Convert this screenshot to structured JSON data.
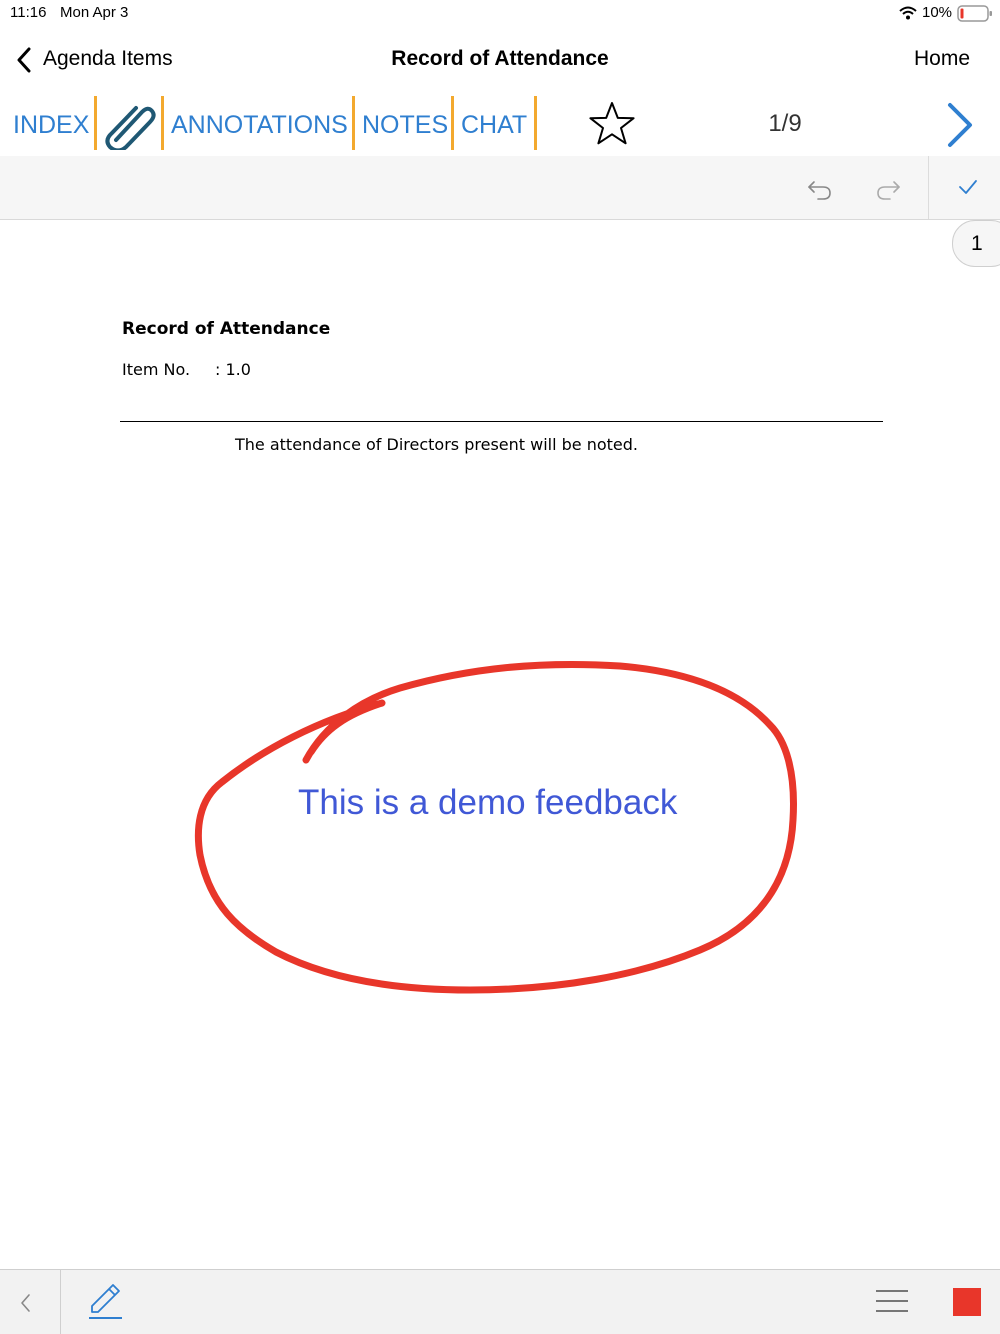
{
  "status_bar": {
    "time": "11:16",
    "date": "Mon Apr 3",
    "battery": "10%"
  },
  "nav": {
    "back_label": "Agenda Items",
    "title": "Record of Attendance",
    "home_label": "Home"
  },
  "tabs": {
    "index": "INDEX",
    "annotations": "ANNOTATIONS",
    "notes": "NOTES",
    "chat": "CHAT",
    "page_counter": "1/9"
  },
  "page_badge": "1",
  "document": {
    "heading": "Record of Attendance",
    "item_label": "Item No.",
    "item_value": ": 1.0",
    "body": "The attendance of Directors present will be noted."
  },
  "annotation": {
    "text": "This is a demo feedback",
    "ink_color": "#e8362a",
    "text_color": "#4058d6"
  },
  "colors": {
    "accent": "#2f7fd0",
    "separator": "#f3a92e",
    "stop_button": "#e8362a"
  }
}
